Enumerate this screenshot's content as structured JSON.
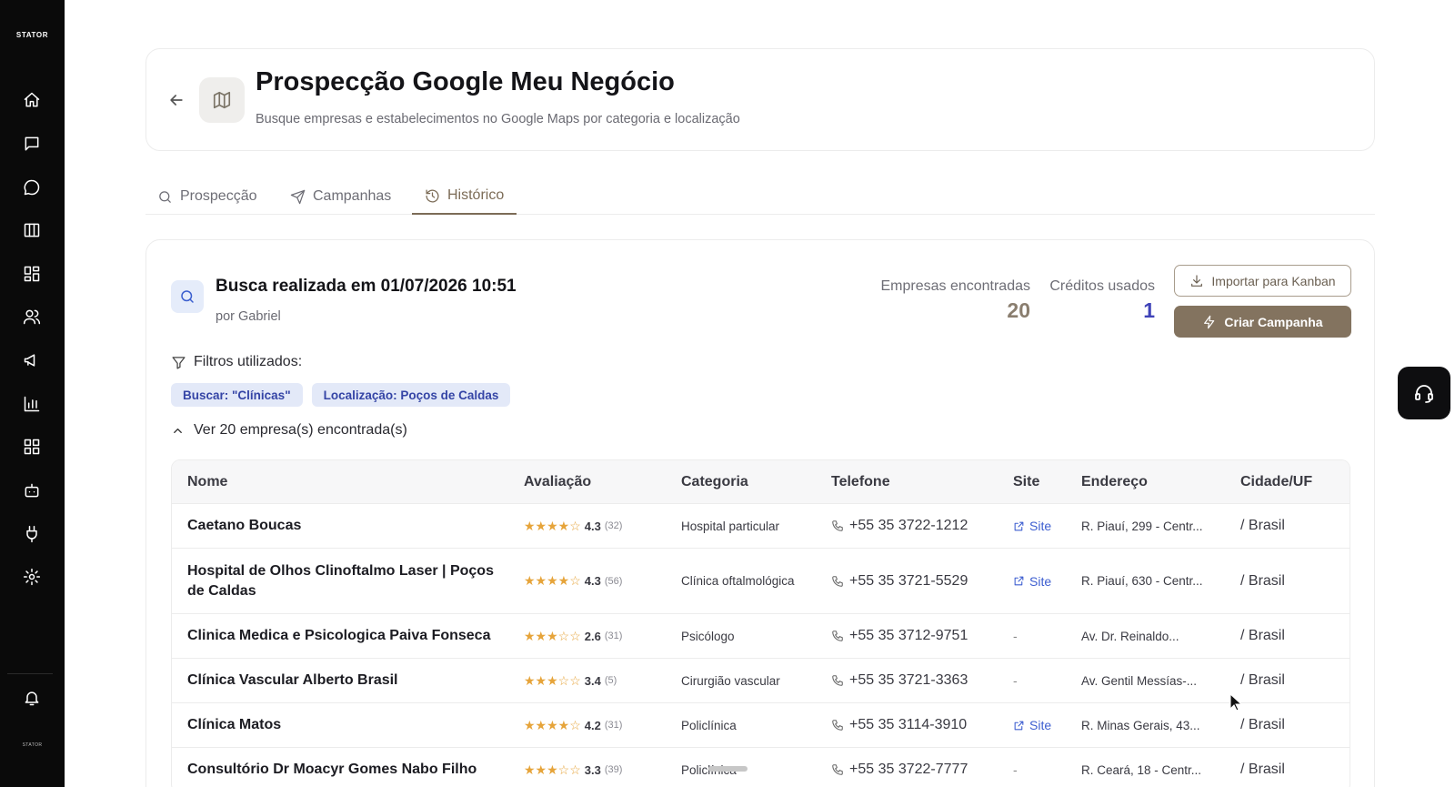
{
  "sidebar": {
    "brand": "STATOR",
    "brand_small": "STATOR",
    "icons": [
      "home-icon",
      "chat-square-icon",
      "chat-bubble-icon",
      "kanban-icon",
      "dashboard-icon",
      "users-icon",
      "megaphone-icon",
      "bar-chart-icon",
      "apps-grid-icon",
      "bot-icon",
      "plug-icon",
      "gear-icon",
      "bell-icon"
    ]
  },
  "header": {
    "title": "Prospecção Google Meu Negócio",
    "subtitle": "Busque empresas e estabelecimentos no Google Maps por categoria e localização"
  },
  "tabs": [
    {
      "label": "Prospecção",
      "icon": "search-icon"
    },
    {
      "label": "Campanhas",
      "icon": "send-icon"
    },
    {
      "label": "Histórico",
      "icon": "history-icon",
      "active": true
    }
  ],
  "search": {
    "title": "Busca realizada em 01/07/2026 10:51",
    "by": "por Gabriel",
    "companies_label": "Empresas encontradas",
    "companies_value": "20",
    "credits_label": "Créditos usados",
    "credits_value": "1",
    "import_button": "Importar para Kanban",
    "campaign_button": "Criar Campanha",
    "filters_label": "Filtros utilizados:",
    "filters": [
      "Buscar: \"Clínicas\"",
      "Localização: Poços de Caldas"
    ],
    "toggle_label": "Ver 20 empresa(s) encontrada(s)"
  },
  "table": {
    "headers": {
      "name": "Nome",
      "rating": "Avaliação",
      "category": "Categoria",
      "phone": "Telefone",
      "site": "Site",
      "address": "Endereço",
      "city": "Cidade/UF"
    },
    "rows": [
      {
        "name": "Caetano Boucas",
        "rating": 4.3,
        "rating_text": "4.3",
        "reviews": "(32)",
        "category": "Hospital particular",
        "phone": "+55 35 3722-1212",
        "site": "Site",
        "address": "R. Piauí, 299 - Centr...",
        "city": "/ Brasil"
      },
      {
        "name": "Hospital de Olhos Clinoftalmo Laser | Poços de Caldas",
        "rating": 4.3,
        "rating_text": "4.3",
        "reviews": "(56)",
        "category": "Clínica oftalmológica",
        "phone": "+55 35 3721-5529",
        "site": "Site",
        "address": "R. Piauí, 630 - Centr...",
        "city": "/ Brasil"
      },
      {
        "name": "Clinica Medica e Psicologica Paiva Fonseca",
        "rating": 2.6,
        "rating_text": "2.6",
        "reviews": "(31)",
        "category": "Psicólogo",
        "phone": "+55 35 3712-9751",
        "site": "-",
        "address": "Av. Dr. Reinaldo...",
        "city": "/ Brasil"
      },
      {
        "name": "Clínica Vascular Alberto Brasil",
        "rating": 3.4,
        "rating_text": "3.4",
        "reviews": "(5)",
        "category": "Cirurgião vascular",
        "phone": "+55 35 3721-3363",
        "site": "-",
        "address": "Av. Gentil Messías-...",
        "city": "/ Brasil"
      },
      {
        "name": "Clínica Matos",
        "rating": 4.2,
        "rating_text": "4.2",
        "reviews": "(31)",
        "category": "Policlínica",
        "phone": "+55 35 3114-3910",
        "site": "Site",
        "address": "R. Minas Gerais, 43...",
        "city": "/ Brasil"
      },
      {
        "name": "Consultório Dr Moacyr Gomes Nabo Filho",
        "rating": 3.3,
        "rating_text": "3.3",
        "reviews": "(39)",
        "category": "Policlínica",
        "phone": "+55 35 3722-7777",
        "site": "-",
        "address": "R. Ceará, 18 - Centr...",
        "city": "/ Brasil"
      }
    ]
  },
  "colors": {
    "accent": "#83735f",
    "link": "#3d5ed0",
    "star": "#e6a43a",
    "sidebar_bg": "#0a0a0a"
  }
}
